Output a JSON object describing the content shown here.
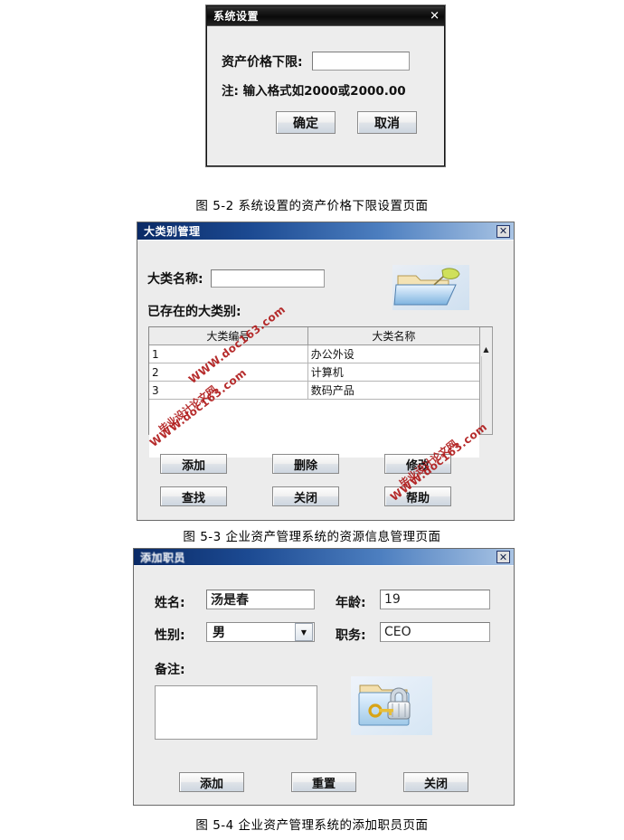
{
  "dialog1": {
    "title": "系统设置",
    "close_label": "✕",
    "field_label": "资产价格下限:",
    "field_value": "",
    "note": "注: 输入格式如2000或2000.00",
    "ok_label": "确定",
    "cancel_label": "取消"
  },
  "caption1": "图 5-2  系统设置的资产价格下限设置页面",
  "dialog2": {
    "title": "大类别管理",
    "close_label": "✕",
    "name_label": "大类名称:",
    "name_value": "",
    "list_label": "已存在的大类别:",
    "table": {
      "headers": [
        "大类编号",
        "大类名称"
      ],
      "rows": [
        [
          "1",
          "办公外设"
        ],
        [
          "2",
          "计算机"
        ],
        [
          "3",
          "数码产品"
        ]
      ]
    },
    "scroll_up": "▲",
    "buttons_row1": [
      "添加",
      "删除",
      "修改"
    ],
    "buttons_row2": [
      "查找",
      "关闭",
      "帮助"
    ]
  },
  "caption2": "图 5-3  企业资产管理系统的资源信息管理页面",
  "dialog3": {
    "title": "添加职员",
    "close_label": "✕",
    "name_label": "姓名:",
    "name_value": "汤是春",
    "age_label": "年龄:",
    "age_value": "19",
    "gender_label": "性别:",
    "gender_value": "男",
    "gender_arrow": "▼",
    "position_label": "职务:",
    "position_value": "CEO",
    "memo_label": "备注:",
    "memo_value": "",
    "buttons": [
      "添加",
      "重置",
      "关闭"
    ]
  },
  "caption3": "图 5-4  企业资产管理系统的添加职员页面",
  "watermark": {
    "line1": "毕业设计论文网",
    "line2": "WWW.doc163.com",
    "color": "#b01b1b"
  }
}
